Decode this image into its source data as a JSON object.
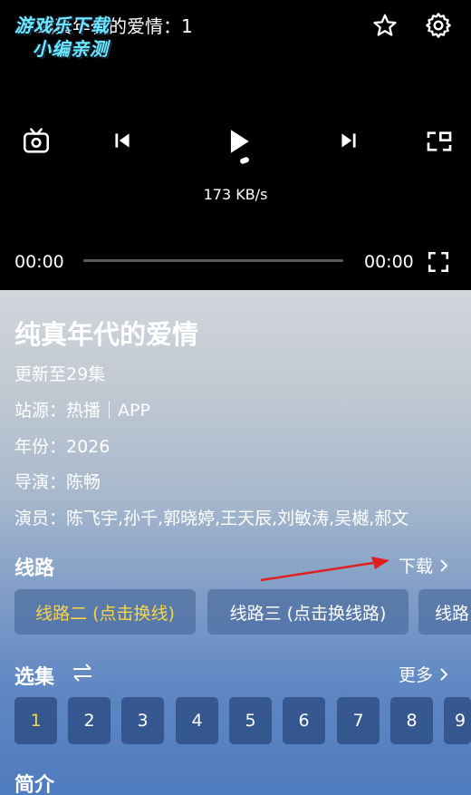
{
  "player": {
    "title": "纯真年代的爱情：1",
    "speed": "173 KB/s",
    "time_current": "00:00",
    "time_total": "00:00",
    "progress": 0,
    "icons": [
      "star-icon",
      "gear-icon",
      "tv-icon",
      "skip-previous-icon",
      "play-icon",
      "skip-next-icon",
      "pip-icon",
      "fullscreen-icon"
    ]
  },
  "watermark": {
    "line1": "游戏乐下载",
    "line2": "小编亲测"
  },
  "show": {
    "title": "纯真年代的爱情",
    "updated": "更新至29集",
    "source": "站源：热播｜APP",
    "year": "年份：2026",
    "director": "导演：陈畅",
    "cast": "演员：陈飞宇,孙千,郭晓婷,王天辰,刘敏涛,吴樾,郝文"
  },
  "lines": {
    "title": "线路",
    "download_label": "下载",
    "items": [
      "线路二 (点击换线)",
      "线路三 (点击换线路)",
      "线路"
    ],
    "active_index": 0
  },
  "episodes": {
    "title": "选集",
    "more_label": "更多",
    "items": [
      "1",
      "2",
      "3",
      "4",
      "5",
      "6",
      "7",
      "8",
      "9"
    ],
    "active_index": 0
  },
  "intro": {
    "title": "简介"
  },
  "colors": {
    "accent_yellow": "#f7d54a",
    "annotation_arrow": "#e02020"
  }
}
